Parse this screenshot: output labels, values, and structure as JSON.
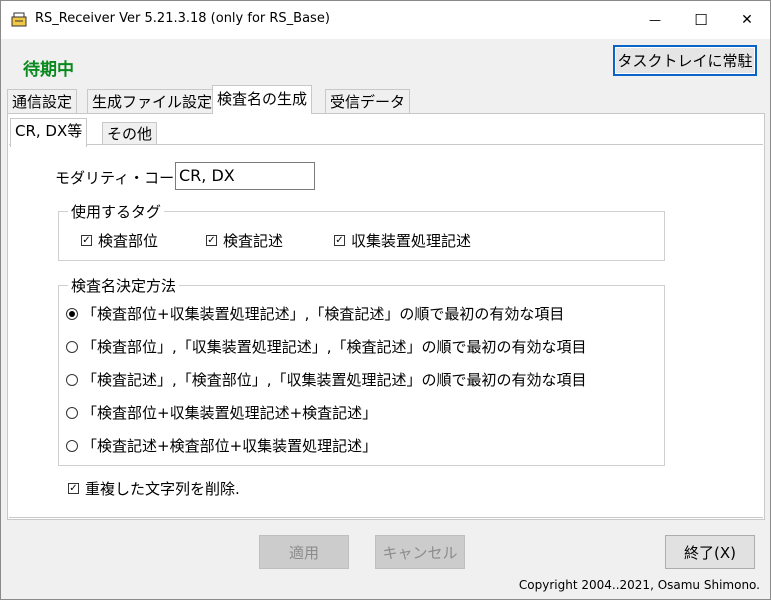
{
  "window": {
    "title": "RS_Receiver Ver 5.21.3.18  (only for RS_Base)",
    "minimize_glyph": "—",
    "maximize_glyph": "☐",
    "close_glyph": "✕"
  },
  "status": "待期中",
  "tray_button_label": "タスクトレイに常駐",
  "tabs": [
    {
      "label": "通信設定"
    },
    {
      "label": "生成ファイル設定"
    },
    {
      "label": "検査名の生成"
    },
    {
      "label": "受信データ"
    }
  ],
  "subtabs": [
    {
      "label": "CR, DX等"
    },
    {
      "label": "その他"
    }
  ],
  "modality": {
    "label": "モダリティ・コード",
    "value": "CR, DX"
  },
  "tags_group": {
    "title": "使用するタグ",
    "items": [
      {
        "label": "検査部位",
        "checked": true
      },
      {
        "label": "検査記述",
        "checked": true
      },
      {
        "label": "収集装置処理記述",
        "checked": true
      }
    ]
  },
  "method_group": {
    "title": "検査名決定方法",
    "options": [
      {
        "label": "「検査部位+収集装置処理記述」,「検査記述」の順で最初の有効な項目",
        "selected": true
      },
      {
        "label": "「検査部位」,「収集装置処理記述」,「検査記述」の順で最初の有効な項目",
        "selected": false
      },
      {
        "label": "「検査記述」,「検査部位」,「収集装置処理記述」の順で最初の有効な項目",
        "selected": false
      },
      {
        "label": "「検査部位+収集装置処理記述+検査記述」",
        "selected": false
      },
      {
        "label": "「検査記述+検査部位+収集装置処理記述」",
        "selected": false
      }
    ]
  },
  "dedupe": {
    "label": "重複した文字列を削除.",
    "checked": true
  },
  "buttons": {
    "apply": "適用",
    "cancel": "キャンセル",
    "exit": "終了(X)"
  },
  "check_glyph": "✓",
  "copyright": "Copyright 2004..2021, Osamu Shimono."
}
